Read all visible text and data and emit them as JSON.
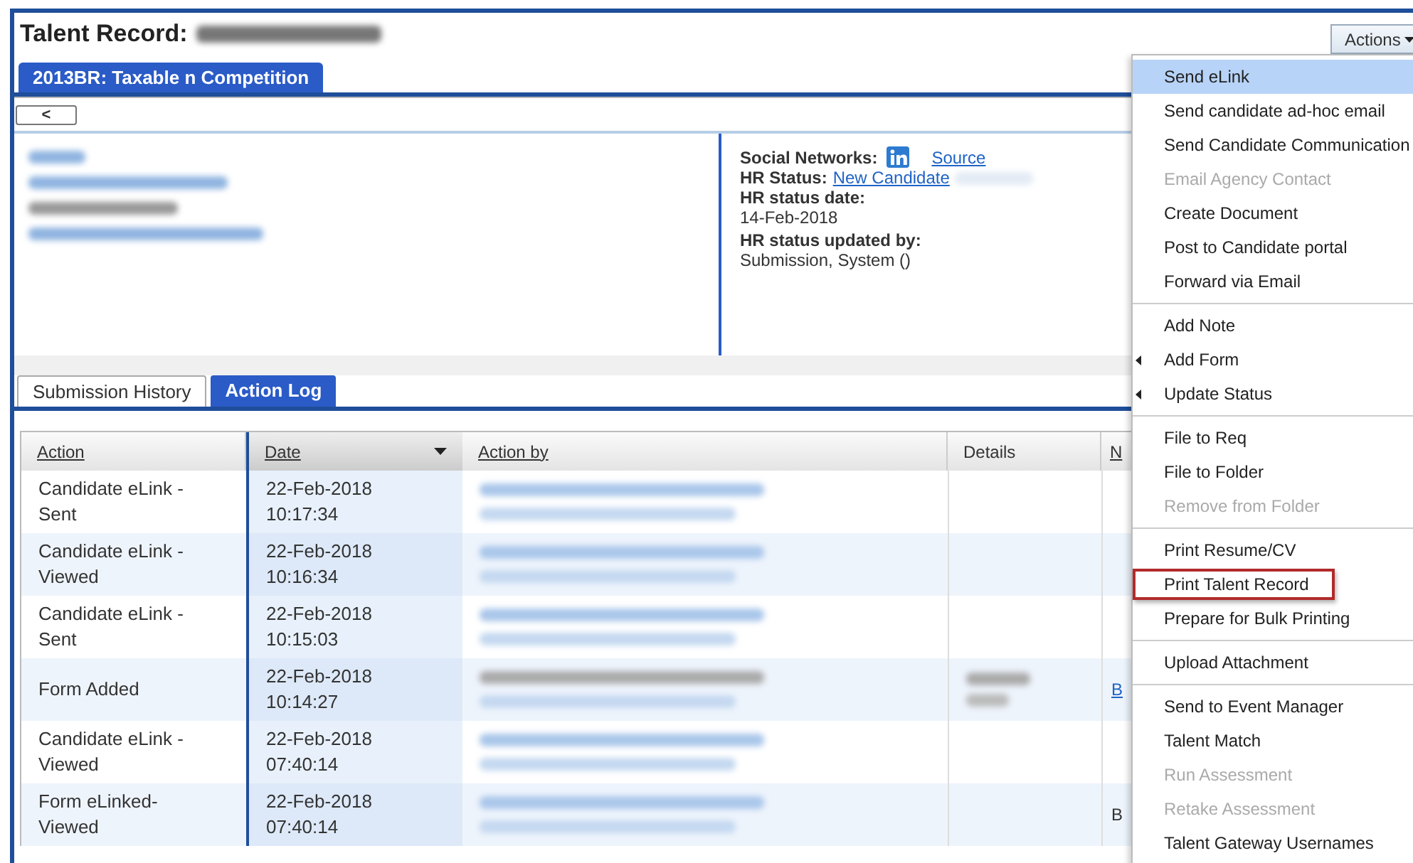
{
  "title": "Talent Record:",
  "record_tab": {
    "label": "2013BR: Taxable n Competition",
    "selected": true
  },
  "back_button": {
    "label": "<"
  },
  "profile": {
    "social_networks_label": "Social Networks:",
    "source_link": "Source",
    "hr_status_label": "HR Status:",
    "hr_status_value": "New Candidate",
    "hr_status_date_label": "HR status date:",
    "hr_status_date": "14-Feb-2018",
    "hr_status_updated_by_label": "HR status updated by:",
    "hr_status_updated_by": "Submission, System ()"
  },
  "tabs": [
    {
      "label": "Submission History",
      "selected": false
    },
    {
      "label": "Action Log",
      "selected": true
    }
  ],
  "table": {
    "columns": [
      {
        "label": "Action",
        "sortable": true,
        "sorted": false
      },
      {
        "label": "Date",
        "sortable": true,
        "sorted": true
      },
      {
        "label": "Action by",
        "sortable": true,
        "sorted": false
      },
      {
        "label": "Details",
        "sortable": false,
        "sorted": false
      },
      {
        "label": "N",
        "sortable": true,
        "sorted": false
      }
    ],
    "rows": [
      {
        "action": "Candidate eLink - Sent",
        "date": "22-Feb-2018 10:17:34"
      },
      {
        "action": "Candidate eLink - Viewed",
        "date": "22-Feb-2018 10:16:34"
      },
      {
        "action": "Candidate eLink - Sent",
        "date": "22-Feb-2018 10:15:03"
      },
      {
        "action": "Form Added",
        "date": "22-Feb-2018 10:14:27",
        "name": "B",
        "name_is_link": true
      },
      {
        "action": "Candidate eLink - Viewed",
        "date": "22-Feb-2018 07:40:14"
      },
      {
        "action": "Form eLinked- Viewed",
        "date": "22-Feb-2018 07:40:14",
        "name": "B",
        "name_is_link": false
      }
    ]
  },
  "actions_button": {
    "label": "Actions"
  },
  "actions_menu": [
    [
      {
        "label": "Send eLink",
        "selected": true,
        "disabled": false,
        "submenu": false,
        "outlined": false
      },
      {
        "label": "Send candidate ad-hoc email",
        "selected": false,
        "disabled": false,
        "submenu": false,
        "outlined": false
      },
      {
        "label": "Send Candidate Communication",
        "selected": false,
        "disabled": false,
        "submenu": false,
        "outlined": false
      },
      {
        "label": "Email Agency Contact",
        "selected": false,
        "disabled": true,
        "submenu": false,
        "outlined": false
      },
      {
        "label": "Create Document",
        "selected": false,
        "disabled": false,
        "submenu": false,
        "outlined": false
      },
      {
        "label": "Post to Candidate portal",
        "selected": false,
        "disabled": false,
        "submenu": false,
        "outlined": false
      },
      {
        "label": "Forward via Email",
        "selected": false,
        "disabled": false,
        "submenu": false,
        "outlined": false
      }
    ],
    [
      {
        "label": "Add Note",
        "selected": false,
        "disabled": false,
        "submenu": false,
        "outlined": false
      },
      {
        "label": "Add Form",
        "selected": false,
        "disabled": false,
        "submenu": true,
        "outlined": false
      },
      {
        "label": "Update Status",
        "selected": false,
        "disabled": false,
        "submenu": true,
        "outlined": false
      }
    ],
    [
      {
        "label": "File to Req",
        "selected": false,
        "disabled": false,
        "submenu": false,
        "outlined": false
      },
      {
        "label": "File to Folder",
        "selected": false,
        "disabled": false,
        "submenu": false,
        "outlined": false
      },
      {
        "label": "Remove from Folder",
        "selected": false,
        "disabled": true,
        "submenu": false,
        "outlined": false
      }
    ],
    [
      {
        "label": "Print Resume/CV",
        "selected": false,
        "disabled": false,
        "submenu": false,
        "outlined": false
      },
      {
        "label": "Print Talent Record",
        "selected": false,
        "disabled": false,
        "submenu": false,
        "outlined": true
      },
      {
        "label": "Prepare for Bulk Printing",
        "selected": false,
        "disabled": false,
        "submenu": false,
        "outlined": false
      }
    ],
    [
      {
        "label": "Upload Attachment",
        "selected": false,
        "disabled": false,
        "submenu": false,
        "outlined": false
      }
    ],
    [
      {
        "label": "Send to Event Manager",
        "selected": false,
        "disabled": false,
        "submenu": false,
        "outlined": false
      },
      {
        "label": "Talent Match",
        "selected": false,
        "disabled": false,
        "submenu": false,
        "outlined": false
      },
      {
        "label": "Run Assessment",
        "selected": false,
        "disabled": true,
        "submenu": false,
        "outlined": false
      },
      {
        "label": "Retake Assessment",
        "selected": false,
        "disabled": true,
        "submenu": false,
        "outlined": false
      },
      {
        "label": "Talent Gateway Usernames",
        "selected": false,
        "disabled": false,
        "submenu": false,
        "outlined": false
      }
    ]
  ]
}
